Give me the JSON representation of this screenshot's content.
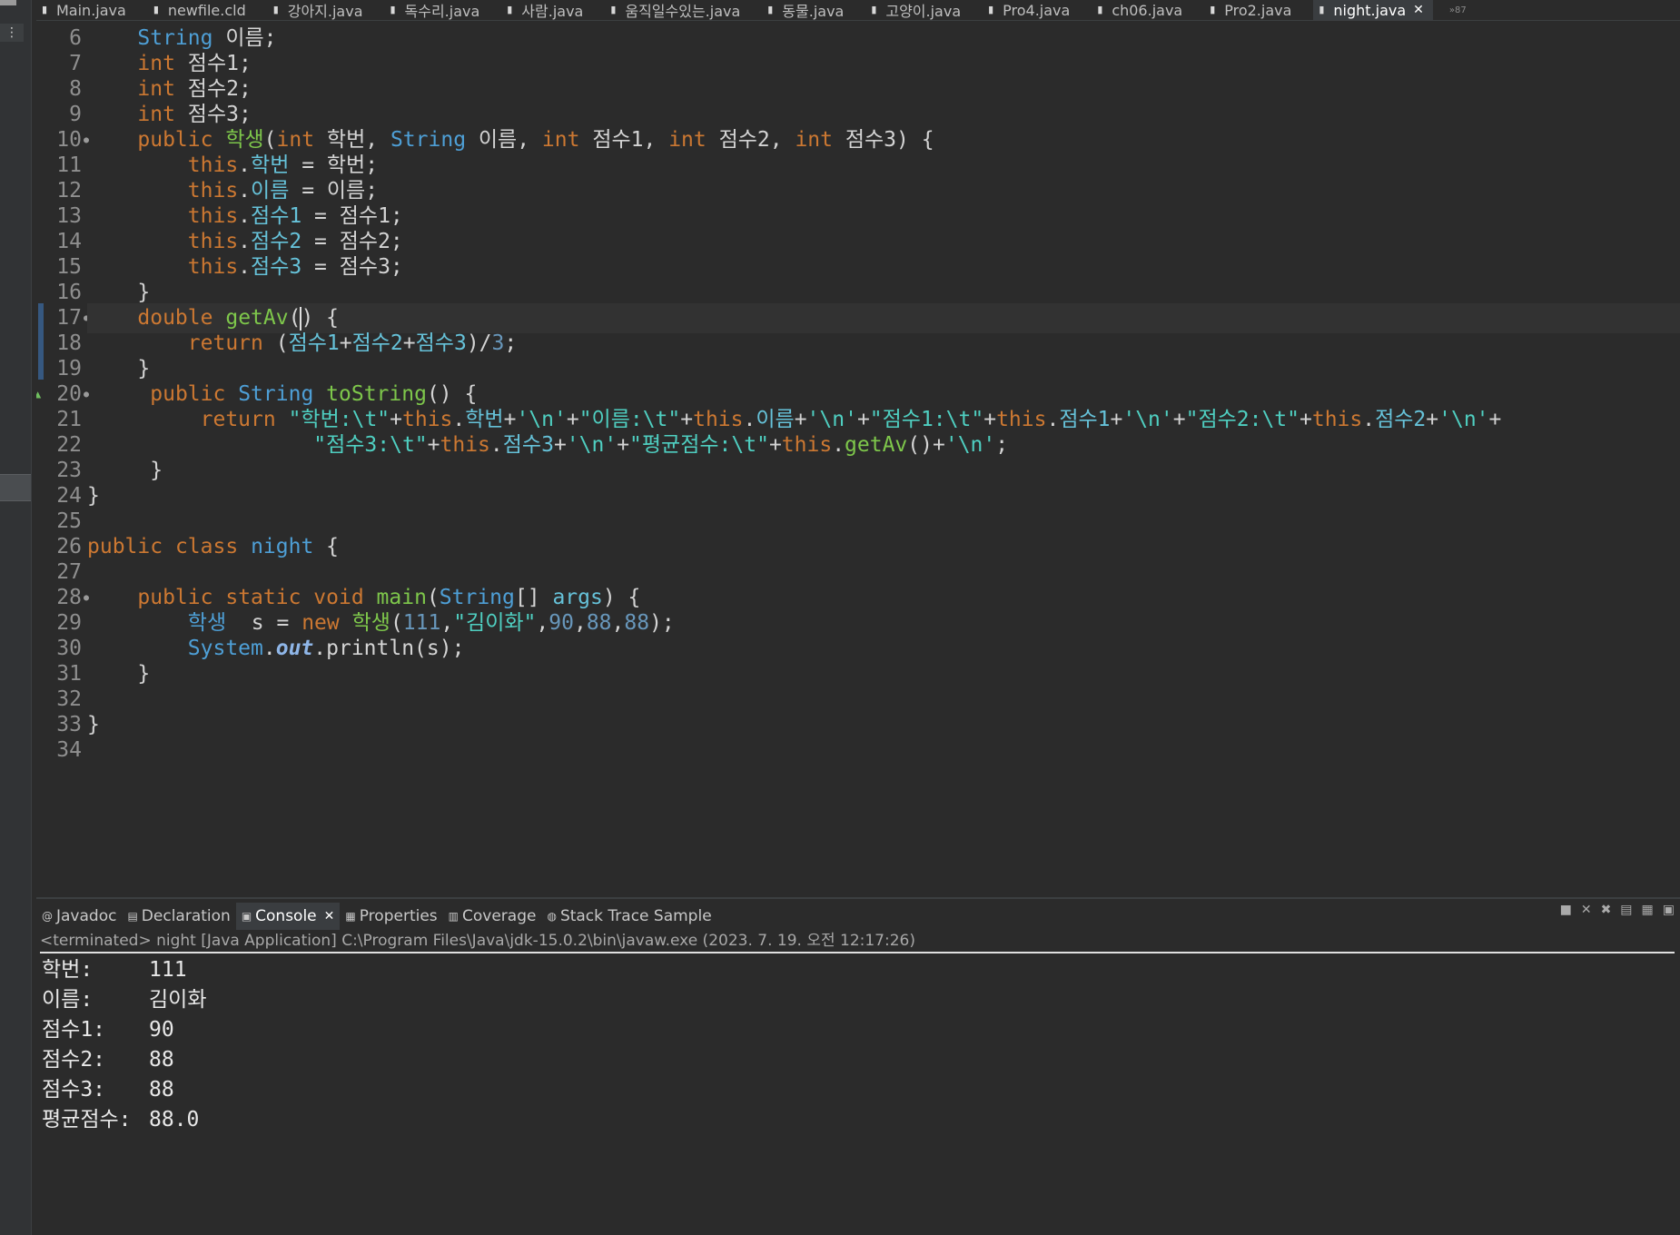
{
  "editor_tabs": {
    "items": [
      {
        "label": "Main.java"
      },
      {
        "label": "newfile.cld"
      },
      {
        "label": "강아지.java"
      },
      {
        "label": "독수리.java"
      },
      {
        "label": "사람.java"
      },
      {
        "label": "움직일수있는.java"
      },
      {
        "label": "동물.java"
      },
      {
        "label": "고양이.java"
      },
      {
        "label": "Pro4.java"
      },
      {
        "label": "ch06.java"
      },
      {
        "label": "Pro2.java"
      },
      {
        "label": "night.java",
        "active": true
      }
    ],
    "close_glyph": "✕",
    "overflow": "»87"
  },
  "code": {
    "lines": [
      {
        "n": "6",
        "t": [
          [
            "    ",
            ""
          ],
          [
            "String",
            "ty"
          ],
          [
            " 이름;",
            "pl"
          ]
        ]
      },
      {
        "n": "7",
        "t": [
          [
            "    ",
            ""
          ],
          [
            "int",
            "kw"
          ],
          [
            " 점수1;",
            "pl"
          ]
        ]
      },
      {
        "n": "8",
        "t": [
          [
            "    ",
            ""
          ],
          [
            "int",
            "kw"
          ],
          [
            " 점수2;",
            "pl"
          ]
        ]
      },
      {
        "n": "9",
        "t": [
          [
            "    ",
            ""
          ],
          [
            "int",
            "kw"
          ],
          [
            " 점수3;",
            "pl"
          ]
        ]
      },
      {
        "n": "10",
        "fold": true,
        "t": [
          [
            "    ",
            ""
          ],
          [
            "public",
            "kw"
          ],
          [
            " ",
            ""
          ],
          [
            "학생",
            "fn"
          ],
          [
            "(",
            "pl"
          ],
          [
            "int",
            "kw"
          ],
          [
            " 학번, ",
            "pl"
          ],
          [
            "String",
            "ty"
          ],
          [
            " 이름, ",
            "pl"
          ],
          [
            "int",
            "kw"
          ],
          [
            " 점수1, ",
            "pl"
          ],
          [
            "int",
            "kw"
          ],
          [
            " 점수2, ",
            "pl"
          ],
          [
            "int",
            "kw"
          ],
          [
            " 점수3) {",
            "pl"
          ]
        ]
      },
      {
        "n": "11",
        "t": [
          [
            "        ",
            ""
          ],
          [
            "this",
            "kw"
          ],
          [
            ".",
            ""
          ],
          [
            "학번",
            "fld"
          ],
          [
            " = 학번;",
            "pl"
          ]
        ]
      },
      {
        "n": "12",
        "t": [
          [
            "        ",
            ""
          ],
          [
            "this",
            "kw"
          ],
          [
            ".",
            ""
          ],
          [
            "이름",
            "fld"
          ],
          [
            " = 이름;",
            "pl"
          ]
        ]
      },
      {
        "n": "13",
        "t": [
          [
            "        ",
            ""
          ],
          [
            "this",
            "kw"
          ],
          [
            ".",
            ""
          ],
          [
            "점수1",
            "fld"
          ],
          [
            " = 점수1;",
            "pl"
          ]
        ]
      },
      {
        "n": "14",
        "t": [
          [
            "        ",
            ""
          ],
          [
            "this",
            "kw"
          ],
          [
            ".",
            ""
          ],
          [
            "점수2",
            "fld"
          ],
          [
            " = 점수2;",
            "pl"
          ]
        ]
      },
      {
        "n": "15",
        "t": [
          [
            "        ",
            ""
          ],
          [
            "this",
            "kw"
          ],
          [
            ".",
            ""
          ],
          [
            "점수3",
            "fld"
          ],
          [
            " = 점수3;",
            "pl"
          ]
        ]
      },
      {
        "n": "16",
        "t": [
          [
            "    }",
            "pl"
          ]
        ]
      },
      {
        "n": "17",
        "fold": true,
        "current": true,
        "t": [
          [
            "    ",
            ""
          ],
          [
            "double",
            "kw"
          ],
          [
            " ",
            ""
          ],
          [
            "getAv",
            "fn"
          ],
          [
            "(",
            "pl"
          ],
          [
            "CARET",
            ""
          ],
          [
            ") {",
            "pl"
          ]
        ]
      },
      {
        "n": "18",
        "t": [
          [
            "        ",
            ""
          ],
          [
            "return",
            "kw"
          ],
          [
            " (",
            ""
          ],
          [
            "점수1",
            "fld"
          ],
          [
            "+",
            ""
          ],
          [
            "점수2",
            "fld"
          ],
          [
            "+",
            ""
          ],
          [
            "점수3",
            "fld"
          ],
          [
            ")/",
            ""
          ],
          [
            "3",
            "num"
          ],
          [
            ";",
            ""
          ]
        ]
      },
      {
        "n": "19",
        "t": [
          [
            "    }",
            "pl"
          ]
        ]
      },
      {
        "n": "20",
        "fold": true,
        "override": true,
        "t": [
          [
            "     ",
            ""
          ],
          [
            "public",
            "kw"
          ],
          [
            " ",
            ""
          ],
          [
            "String",
            "ty"
          ],
          [
            " ",
            ""
          ],
          [
            "toString",
            "fn"
          ],
          [
            "() {",
            "pl"
          ]
        ]
      },
      {
        "n": "21",
        "t": [
          [
            "         ",
            ""
          ],
          [
            "return",
            "kw"
          ],
          [
            " ",
            ""
          ],
          [
            "\"학번:\\t\"",
            "str"
          ],
          [
            "+",
            ""
          ],
          [
            "this",
            "kw"
          ],
          [
            ".",
            ""
          ],
          [
            "학번",
            "fld"
          ],
          [
            "+",
            ""
          ],
          [
            "'\\n'",
            "str"
          ],
          [
            "+",
            ""
          ],
          [
            "\"이름:\\t\"",
            "str"
          ],
          [
            "+",
            ""
          ],
          [
            "this",
            "kw"
          ],
          [
            ".",
            ""
          ],
          [
            "이름",
            "fld"
          ],
          [
            "+",
            ""
          ],
          [
            "'\\n'",
            "str"
          ],
          [
            "+",
            ""
          ],
          [
            "\"점수1:\\t\"",
            "str"
          ],
          [
            "+",
            ""
          ],
          [
            "this",
            "kw"
          ],
          [
            ".",
            ""
          ],
          [
            "점수1",
            "fld"
          ],
          [
            "+",
            ""
          ],
          [
            "'\\n'",
            "str"
          ],
          [
            "+",
            ""
          ],
          [
            "\"점수2:\\t\"",
            "str"
          ],
          [
            "+",
            ""
          ],
          [
            "this",
            "kw"
          ],
          [
            ".",
            ""
          ],
          [
            "점수2",
            "fld"
          ],
          [
            "+",
            ""
          ],
          [
            "'\\n'",
            "str"
          ],
          [
            "+",
            ""
          ]
        ]
      },
      {
        "n": "22",
        "t": [
          [
            "                  ",
            ""
          ],
          [
            "\"점수3:\\t\"",
            "str"
          ],
          [
            "+",
            ""
          ],
          [
            "this",
            "kw"
          ],
          [
            ".",
            ""
          ],
          [
            "점수3",
            "fld"
          ],
          [
            "+",
            ""
          ],
          [
            "'\\n'",
            "str"
          ],
          [
            "+",
            ""
          ],
          [
            "\"평균점수:\\t\"",
            "str"
          ],
          [
            "+",
            ""
          ],
          [
            "this",
            "kw"
          ],
          [
            ".",
            ""
          ],
          [
            "getAv",
            "fn"
          ],
          [
            "()+",
            ""
          ],
          [
            "'\\n'",
            "str"
          ],
          [
            ";",
            ""
          ]
        ]
      },
      {
        "n": "23",
        "t": [
          [
            "     }",
            "pl"
          ]
        ]
      },
      {
        "n": "24",
        "t": [
          [
            "}",
            "pl"
          ]
        ]
      },
      {
        "n": "25",
        "t": []
      },
      {
        "n": "26",
        "t": [
          [
            "public",
            "kw"
          ],
          [
            " ",
            ""
          ],
          [
            "class",
            "kw"
          ],
          [
            " ",
            ""
          ],
          [
            "night",
            "ty"
          ],
          [
            " {",
            "pl"
          ]
        ]
      },
      {
        "n": "27",
        "t": []
      },
      {
        "n": "28",
        "fold": true,
        "t": [
          [
            "    ",
            ""
          ],
          [
            "public",
            "kw"
          ],
          [
            " ",
            ""
          ],
          [
            "static",
            "kw"
          ],
          [
            " ",
            ""
          ],
          [
            "void",
            "kw"
          ],
          [
            " ",
            ""
          ],
          [
            "main",
            "fn"
          ],
          [
            "(",
            ""
          ],
          [
            "String",
            "ty"
          ],
          [
            "[] ",
            ""
          ],
          [
            "args",
            "fld"
          ],
          [
            ") {",
            ""
          ]
        ]
      },
      {
        "n": "29",
        "t": [
          [
            "        ",
            ""
          ],
          [
            "학생",
            "ty"
          ],
          [
            "  s = ",
            ""
          ],
          [
            "new",
            "kw"
          ],
          [
            " ",
            ""
          ],
          [
            "학생",
            "fn"
          ],
          [
            "(",
            ""
          ],
          [
            "111",
            "num"
          ],
          [
            ",",
            ""
          ],
          [
            "\"김이화\"",
            "str"
          ],
          [
            ",",
            ""
          ],
          [
            "90",
            "num"
          ],
          [
            ",",
            ""
          ],
          [
            "88",
            "num"
          ],
          [
            ",",
            ""
          ],
          [
            "88",
            "num"
          ],
          [
            ");",
            ""
          ]
        ]
      },
      {
        "n": "30",
        "t": [
          [
            "        ",
            ""
          ],
          [
            "System",
            "ty"
          ],
          [
            ".",
            ""
          ],
          [
            "out",
            "it"
          ],
          [
            ".println(s);",
            ""
          ]
        ]
      },
      {
        "n": "31",
        "t": [
          [
            "    }",
            "pl"
          ]
        ]
      },
      {
        "n": "32",
        "t": []
      },
      {
        "n": "33",
        "t": [
          [
            "}",
            "pl"
          ]
        ]
      },
      {
        "n": "34",
        "t": []
      }
    ]
  },
  "views": {
    "tabs": [
      {
        "label": "Javadoc",
        "icon": "@"
      },
      {
        "label": "Declaration",
        "icon": "▤"
      },
      {
        "label": "Console",
        "icon": "▣",
        "active": true
      },
      {
        "label": "Properties",
        "icon": "▦"
      },
      {
        "label": "Coverage",
        "icon": "▥"
      },
      {
        "label": "Stack Trace Sample",
        "icon": "◍"
      }
    ],
    "close_glyph": "✕"
  },
  "console": {
    "status": "<terminated> night [Java Application] C:\\Program Files\\Java\\jdk-15.0.2\\bin\\javaw.exe (2023. 7. 19. 오전 12:17:26)",
    "output": [
      {
        "key": "학번:",
        "value": "111"
      },
      {
        "key": "이름:",
        "value": "김이화"
      },
      {
        "key": "점수1:",
        "value": "90"
      },
      {
        "key": "점수2:",
        "value": "88"
      },
      {
        "key": "점수3:",
        "value": "88"
      },
      {
        "key": "평균점수:",
        "value": "88.0"
      }
    ]
  }
}
